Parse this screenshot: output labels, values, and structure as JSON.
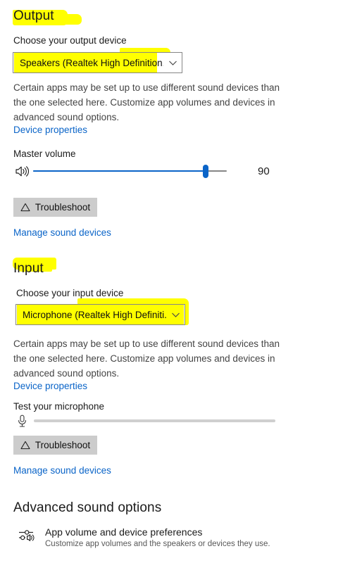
{
  "output": {
    "heading": "Output",
    "device_label": "Choose your output device",
    "device_value": "Speakers (Realtek High Definition...",
    "description": "Certain apps may be set up to use different sound devices than the one selected here. Customize app volumes and devices in advanced sound options.",
    "device_properties_link": "Device properties",
    "volume_label": "Master volume",
    "volume_value": "90",
    "troubleshoot_button": "Troubleshoot",
    "manage_link": "Manage sound devices",
    "icons": {
      "speaker": "speaker-volume-icon",
      "chevron": "chevron-down-icon",
      "warning": "warning-triangle-icon"
    }
  },
  "input": {
    "heading": "Input",
    "device_label": "Choose your input device",
    "device_value": "Microphone (Realtek High Definiti...",
    "description": "Certain apps may be set up to use different sound devices than the one selected here. Customize app volumes and devices in advanced sound options.",
    "device_properties_link": "Device properties",
    "test_label": "Test your microphone",
    "troubleshoot_button": "Troubleshoot",
    "manage_link": "Manage sound devices",
    "icons": {
      "microphone": "microphone-icon",
      "chevron": "chevron-down-icon",
      "warning": "warning-triangle-icon"
    }
  },
  "advanced": {
    "heading": "Advanced sound options",
    "app_volume_title": "App volume and device preferences",
    "app_volume_subtitle": "Customize app volumes and the speakers or devices they use.",
    "icons": {
      "mixer": "audio-mixer-sliders-icon"
    }
  },
  "colors": {
    "highlight": "#ffff00",
    "link": "#0a64c8",
    "accent": "#0a64c8",
    "button_bg": "#cccccc",
    "text": "#1b1b1b",
    "muted_text": "#444444"
  }
}
